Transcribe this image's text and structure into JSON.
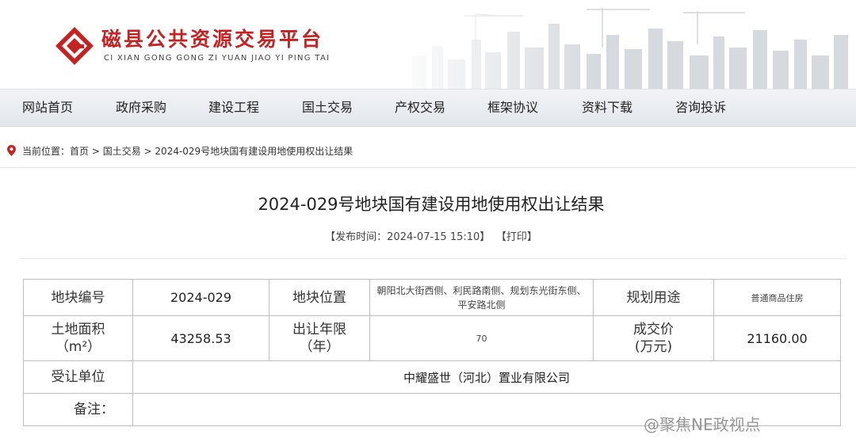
{
  "site": {
    "title": "磁县公共资源交易平台",
    "subtitle": "CI XIAN GONG GONG ZI YUAN JIAO YI PING TAI",
    "brand_color": "#c22323"
  },
  "nav": {
    "items": [
      "网站首页",
      "政府采购",
      "建设工程",
      "国土交易",
      "产权交易",
      "框架协议",
      "资料下载",
      "咨询投诉"
    ]
  },
  "breadcrumb": {
    "prefix": "当前位置：",
    "home": "首页",
    "sep1": " > ",
    "section": "国土交易",
    "sep2": " > ",
    "current": "2024-029号地块国有建设用地使用权出让结果"
  },
  "article": {
    "title": "2024-029号地块国有建设用地使用权出让结果",
    "publish_label": "【发布时间：2024-07-15 15:10】",
    "print_label": "【打印】"
  },
  "table": {
    "parcel_no_label": "地块编号",
    "parcel_no": "2024-029",
    "location_label": "地块位置",
    "location": "朝阳北大街西侧、利民路南侧、规划东光街东侧、平安路北侧",
    "use_label": "规划用途",
    "use": "普通商品住房",
    "area_label_1": "土地面积",
    "area_label_2": "（m²）",
    "area": "43258.53",
    "term_label_1": "出让年限",
    "term_label_2": "（年）",
    "term": "70",
    "price_label_1": "成交价",
    "price_label_2": "(万元)",
    "price": "21160.00",
    "buyer_label": "受让单位",
    "buyer": "中耀盛世（河北）置业有限公司",
    "remark_label": "备注：",
    "remark": ""
  },
  "watermark": "@聚焦NE政视点",
  "icons": {
    "logo": "logo-mark-icon",
    "location": "location-pin-icon"
  }
}
